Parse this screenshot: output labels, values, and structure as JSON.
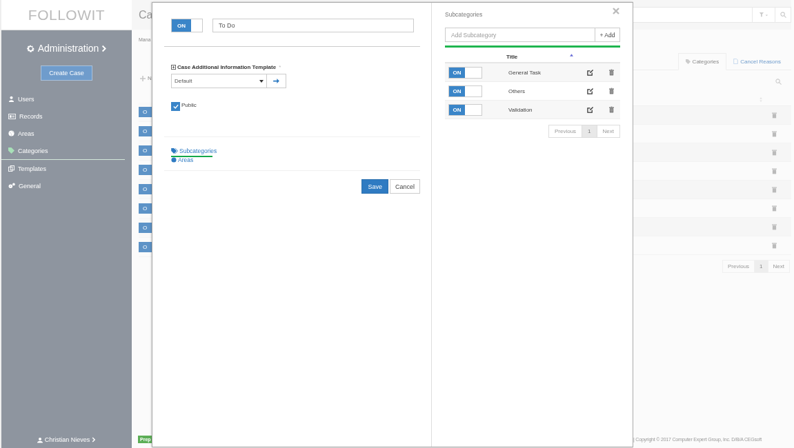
{
  "sidebar": {
    "logo": "FOLLOWIT",
    "heading": "Administration",
    "create_button": "Create Case",
    "items": [
      {
        "label": "Users",
        "selected": false
      },
      {
        "label": "Records",
        "selected": false
      },
      {
        "label": "Areas",
        "selected": false
      },
      {
        "label": "Categories",
        "selected": true
      },
      {
        "label": "Templates",
        "selected": false
      },
      {
        "label": "General",
        "selected": false
      }
    ],
    "user": "Christian Nieves"
  },
  "background": {
    "title": "Ca",
    "subtitle": "Mana",
    "new_label": "N",
    "rows": [
      {
        "toggle": "O",
        "on": true
      },
      {
        "toggle": "O",
        "on": true
      },
      {
        "toggle": "O",
        "on": true
      },
      {
        "toggle": "O",
        "on": true
      },
      {
        "toggle": "O",
        "on": true
      },
      {
        "toggle": "O",
        "on": true
      },
      {
        "toggle": "O",
        "on": true
      },
      {
        "toggle": "O",
        "on": true
      }
    ],
    "badge": "Prep",
    "tabs": [
      {
        "label": "Categories",
        "selected": true
      },
      {
        "label": "Cancel Reasons",
        "selected": false
      }
    ],
    "pagination": {
      "previous": "Previous",
      "page": "1",
      "next": "Next"
    },
    "copyright": "| Copyright © 2017 Computer Expert Group, Inc. D/B/A CEGsoft"
  },
  "modal": {
    "toggle": {
      "label": "ON",
      "on": true
    },
    "name_value": "To Do",
    "template_label": "Case Additional Information Template",
    "required_mark": "*",
    "template_value": "Default",
    "checkbox": {
      "label": "Public",
      "checked": true
    },
    "links": [
      "Subcategories",
      "Areas"
    ],
    "save": "Save",
    "cancel": "Cancel",
    "subcategories": {
      "title": "Subcategories",
      "placeholder": "Add Subcategory",
      "add_button": "+ Add",
      "column_title": "Title",
      "rows": [
        {
          "toggle": "ON",
          "on": true,
          "title": "General Task"
        },
        {
          "toggle": "ON",
          "on": true,
          "title": "Others"
        },
        {
          "toggle": "ON",
          "on": true,
          "title": "Validation"
        }
      ],
      "pagination": {
        "previous": "Previous",
        "page": "1",
        "next": "Next"
      }
    }
  }
}
